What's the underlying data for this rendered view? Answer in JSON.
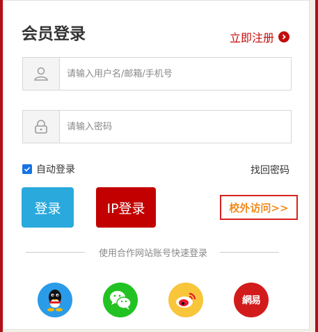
{
  "header": {
    "title": "会员登录",
    "register_label": "立即注册"
  },
  "form": {
    "username_placeholder": "请输入用户名/邮箱/手机号",
    "password_placeholder": "请输入密码",
    "auto_login_label": "自动登录",
    "auto_login_checked": true,
    "forgot_label": "找回密码"
  },
  "buttons": {
    "login_label": "登录",
    "ip_login_label": "IP登录",
    "offsite_label": "校外访问>>"
  },
  "partner": {
    "divider_text": "使用合作网站账号快速登录",
    "items": [
      {
        "name": "qq",
        "icon": "qq-icon",
        "color": "#2a9be8"
      },
      {
        "name": "wechat",
        "icon": "wechat-icon",
        "color": "#22c222"
      },
      {
        "name": "weibo",
        "icon": "weibo-icon",
        "color": "#f8c53b"
      },
      {
        "name": "netease",
        "icon": "netease-icon",
        "color": "#d21c1c"
      }
    ],
    "netease_glyph": "網易"
  },
  "colors": {
    "brand_red": "#c30d0d",
    "login_blue": "#2aa9dd",
    "ip_red": "#c30000",
    "offsite_orange": "#f08a1c"
  }
}
